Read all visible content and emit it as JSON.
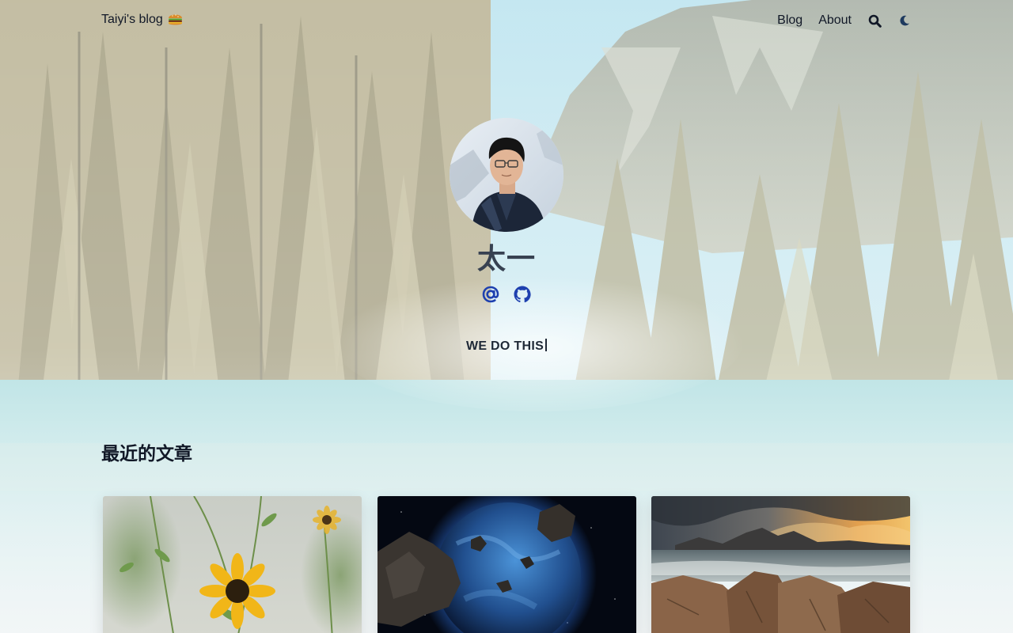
{
  "header": {
    "site_title": "Taiyi's blog",
    "logo_emoji_icon": "hamburger-emoji-icon",
    "nav": [
      {
        "label": "Blog"
      },
      {
        "label": "About"
      }
    ],
    "search_icon": "search-icon",
    "theme_icon": "moon-icon"
  },
  "profile": {
    "name": "太一",
    "social_icons": [
      "email-at-icon",
      "github-icon"
    ],
    "tagline": "WE DO THIS"
  },
  "recent": {
    "title": "最近的文章",
    "posts": [
      {
        "image": "sunflower-photo"
      },
      {
        "image": "planet-asteroids-photo"
      },
      {
        "image": "rocky-coast-sunset-photo"
      }
    ]
  },
  "colors": {
    "text": "#111827",
    "icon_blue": "#1e40af"
  }
}
